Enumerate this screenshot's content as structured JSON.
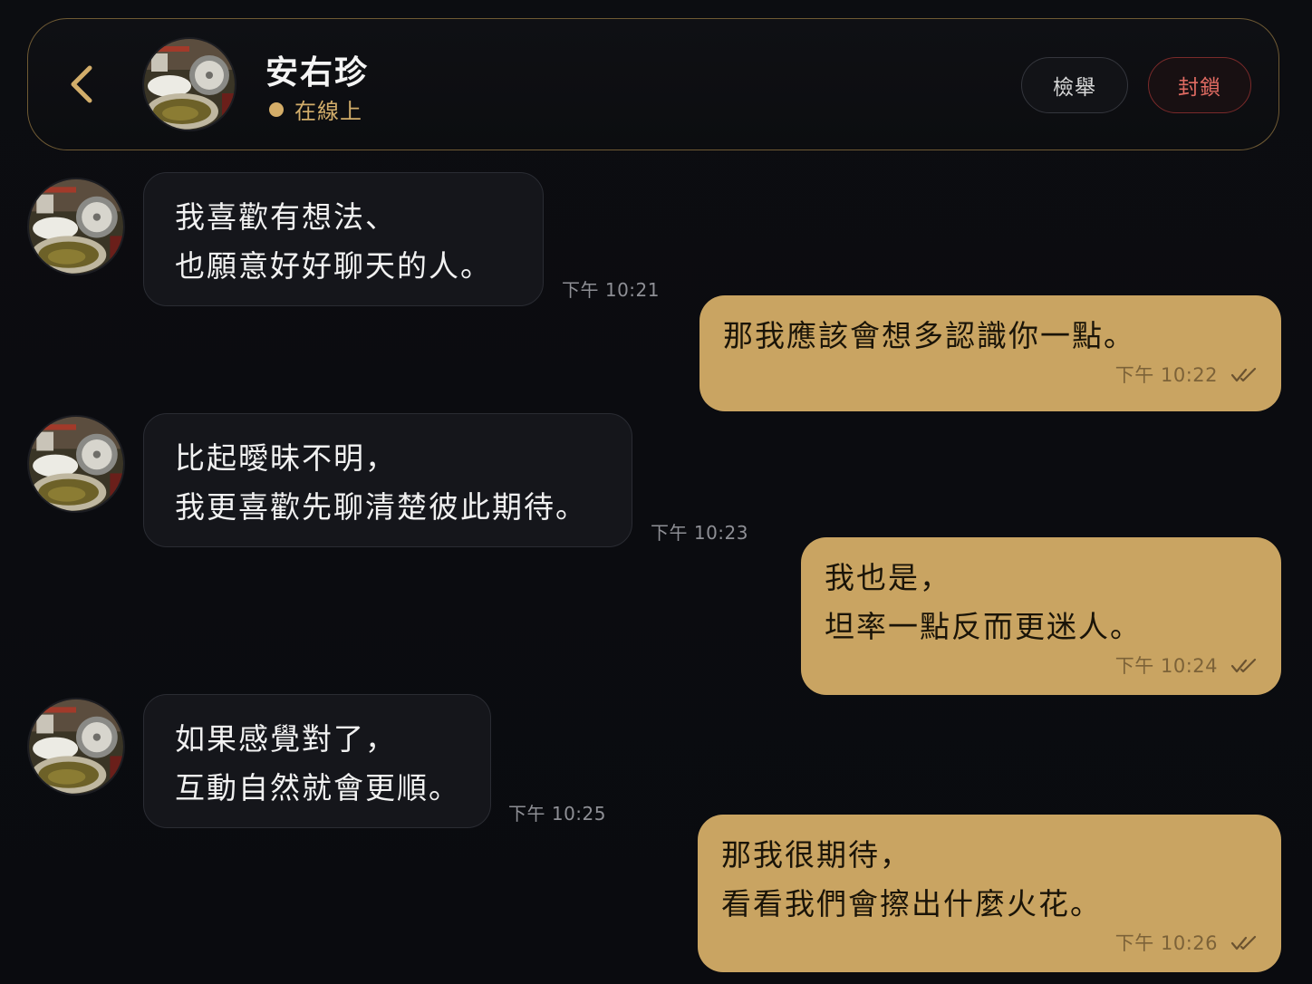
{
  "header": {
    "contact_name": "安右珍",
    "status_text": "在線上",
    "report_label": "檢舉",
    "block_label": "封鎖",
    "back_icon": "chevron-left-icon"
  },
  "colors": {
    "accent_gold": "#c9a462",
    "online_dot": "#d4ad68",
    "block_red": "#e06b62",
    "background": "#0b0c10"
  },
  "messages": [
    {
      "direction": "incoming",
      "lines": [
        "我喜歡有想法、",
        "也願意好好聊天的人。"
      ],
      "time": "下午 10:21"
    },
    {
      "direction": "outgoing",
      "lines": [
        "那我應該會想多認識你一點。"
      ],
      "time": "下午 10:22",
      "read": true
    },
    {
      "direction": "incoming",
      "lines": [
        "比起曖昧不明，",
        "我更喜歡先聊清楚彼此期待。"
      ],
      "time": "下午 10:23"
    },
    {
      "direction": "outgoing",
      "lines": [
        "我也是，",
        "坦率一點反而更迷人。"
      ],
      "time": "下午 10:24",
      "read": true
    },
    {
      "direction": "incoming",
      "lines": [
        "如果感覺對了，",
        "互動自然就會更順。"
      ],
      "time": "下午 10:25"
    },
    {
      "direction": "outgoing",
      "lines": [
        "那我很期待，",
        "看看我們會擦出什麼火花。"
      ],
      "time": "下午 10:26",
      "read": true
    }
  ]
}
